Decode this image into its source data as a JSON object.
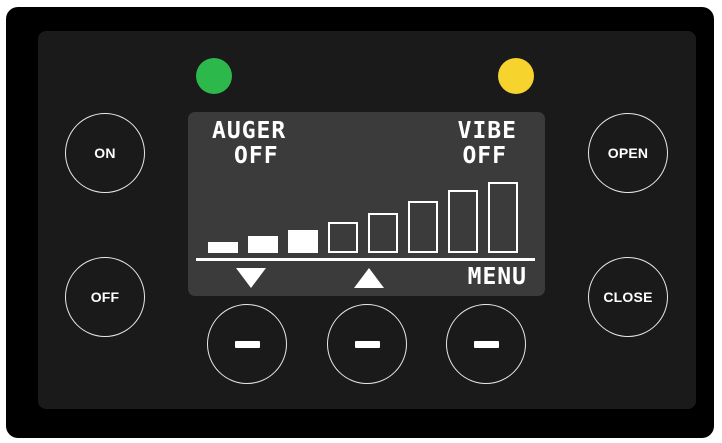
{
  "colors": {
    "frame": "#000000",
    "panel": "#1a1a1a",
    "lcd_background": "#3b3b3b",
    "lcd_foreground": "#ffffff",
    "led_left": "#2db84b",
    "led_right": "#f7d32e"
  },
  "indicators": {
    "left_led": {
      "color_name": "green",
      "status": "on"
    },
    "right_led": {
      "color_name": "yellow",
      "status": "on"
    }
  },
  "buttons": {
    "on": "ON",
    "off": "OFF",
    "open": "OPEN",
    "close": "CLOSE"
  },
  "display": {
    "auger_label": "AUGER",
    "auger_state": "OFF",
    "vibe_label": "VIBE",
    "vibe_state": "OFF",
    "menu_label": "MENU",
    "level_bars": {
      "total": 8,
      "filled": 3
    },
    "icons": [
      "down-arrow-icon",
      "up-arrow-icon"
    ]
  },
  "soft_keys": [
    {
      "icon": "dash-icon"
    },
    {
      "icon": "dash-icon"
    },
    {
      "icon": "dash-icon"
    }
  ]
}
